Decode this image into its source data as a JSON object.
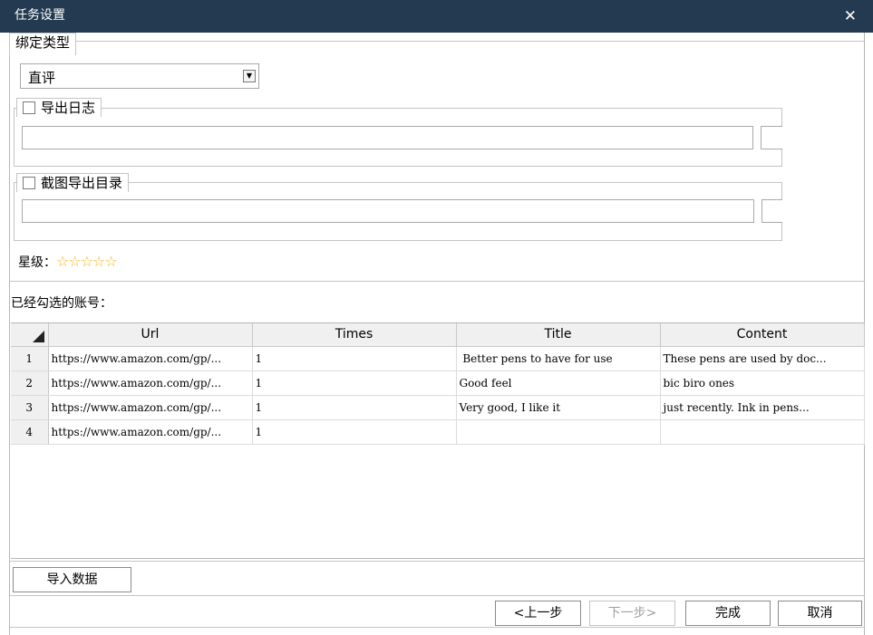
{
  "window": {
    "title": "任务设置",
    "close_glyph": "✕"
  },
  "binding": {
    "legend": "绑定类型",
    "select_value": "直评",
    "select_arrow": "▼"
  },
  "export_log": {
    "label": "导出日志",
    "checked": false,
    "path_value": ""
  },
  "screenshot_dir": {
    "label": "截图导出目录",
    "checked": false,
    "path_value": ""
  },
  "rating": {
    "label": "星级：",
    "stars": "☆☆☆☆☆",
    "value": 0,
    "max": 5,
    "star_color": "#f3b41b"
  },
  "accounts": {
    "label": "已经勾选的账号："
  },
  "grid": {
    "columns": [
      "Url",
      "Times",
      "Title",
      "Content"
    ],
    "rows": [
      {
        "num": "1",
        "url": "https://www.amazon.com/gp/...",
        "times": "1",
        "title": " Better pens to have for use",
        "content": "These pens are used by doc..."
      },
      {
        "num": "2",
        "url": "https://www.amazon.com/gp/...",
        "times": "1",
        "title": "Good feel",
        "content": "bic biro ones"
      },
      {
        "num": "3",
        "url": "https://www.amazon.com/gp/...",
        "times": "1",
        "title": "Very good, I like it",
        "content": "just recently. Ink in pens..."
      },
      {
        "num": "4",
        "url": "https://www.amazon.com/gp/...",
        "times": "1",
        "title": "",
        "content": ""
      }
    ]
  },
  "buttons": {
    "import": "导入数据",
    "prev": "<上一步",
    "next": "下一步>",
    "finish": "完成",
    "cancel": "取消"
  },
  "colors": {
    "titlebar": "#233a50",
    "border": "#c4c4c4"
  }
}
